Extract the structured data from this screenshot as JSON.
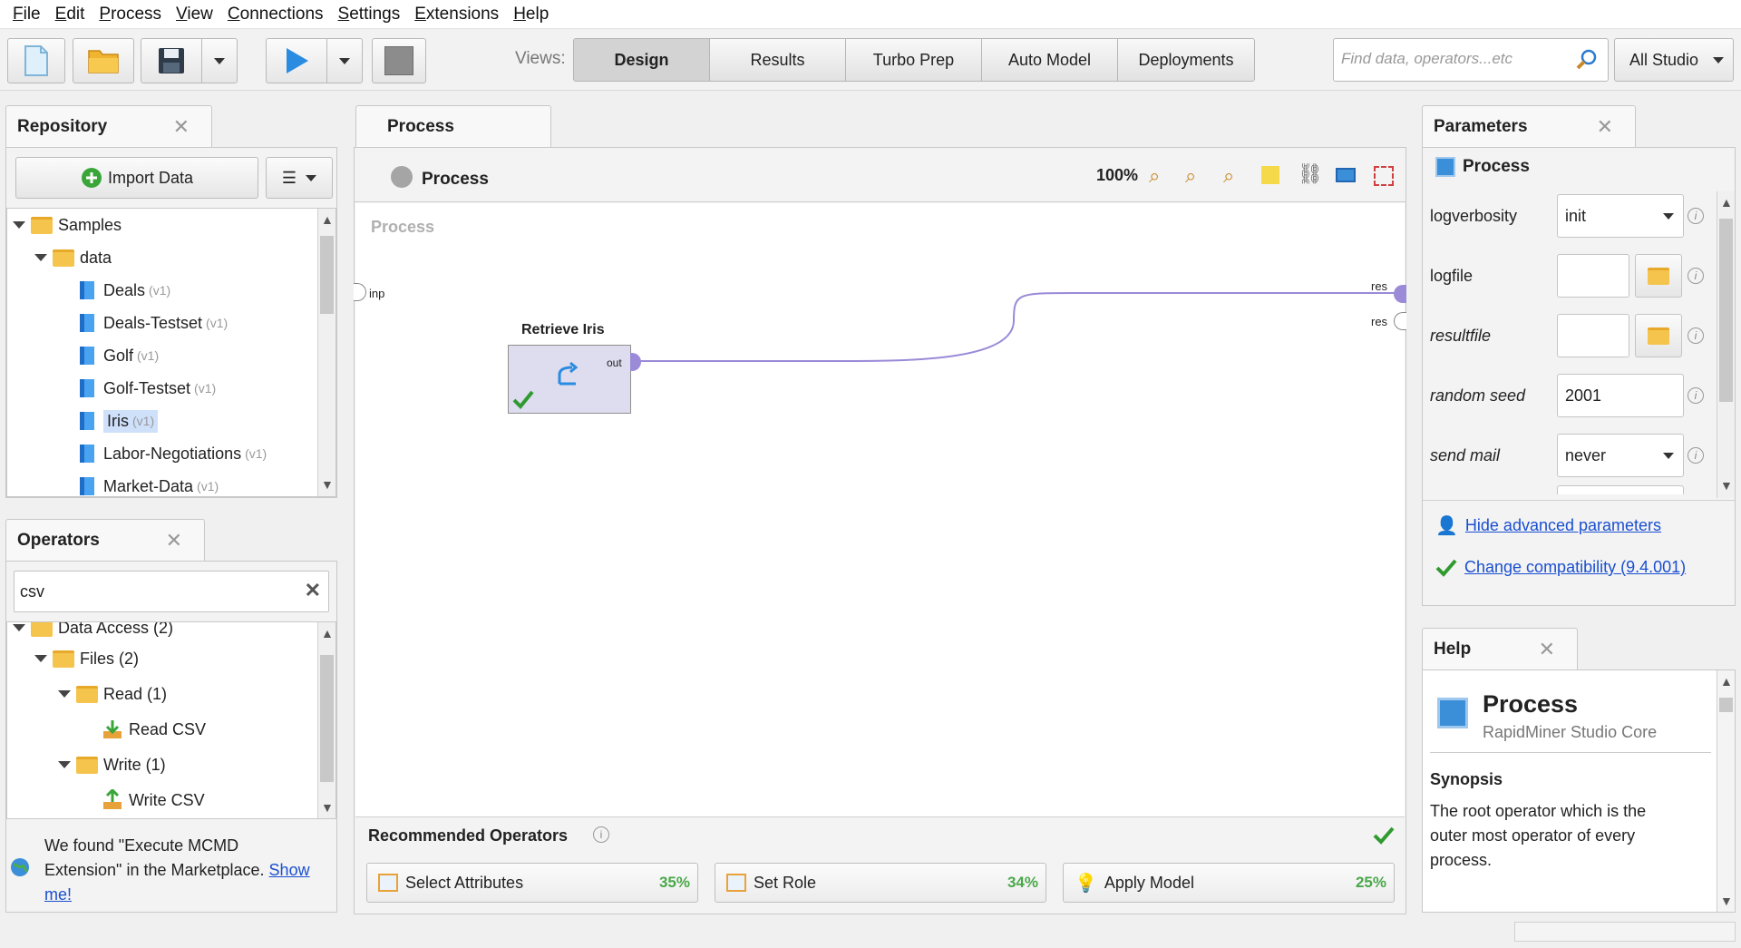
{
  "menu": [
    {
      "u": "F",
      "rest": "ile"
    },
    {
      "u": "E",
      "rest": "dit"
    },
    {
      "u": "P",
      "rest": "rocess"
    },
    {
      "u": "V",
      "rest": "iew"
    },
    {
      "u": "C",
      "rest": "onnections"
    },
    {
      "u": "S",
      "rest": "ettings"
    },
    {
      "u": "E",
      "rest": "xtensions"
    },
    {
      "u": "H",
      "rest": "elp"
    }
  ],
  "toolbar": {
    "views_label": "Views:",
    "views": [
      "Design",
      "Results",
      "Turbo Prep",
      "Auto Model",
      "Deployments"
    ],
    "active_view": "Design",
    "search_placeholder": "Find data, operators...etc",
    "scope": "All Studio"
  },
  "repository": {
    "title": "Repository",
    "import_label": "Import Data",
    "items": [
      {
        "label": "Samples",
        "type": "folder",
        "level": 0,
        "version": ""
      },
      {
        "label": "data",
        "type": "folder-locked",
        "level": 1,
        "version": ""
      },
      {
        "label": "Deals",
        "type": "dataset",
        "level": 2,
        "version": "(v1)"
      },
      {
        "label": "Deals-Testset",
        "type": "dataset",
        "level": 2,
        "version": "(v1)"
      },
      {
        "label": "Golf",
        "type": "dataset",
        "level": 2,
        "version": "(v1)"
      },
      {
        "label": "Golf-Testset",
        "type": "dataset",
        "level": 2,
        "version": "(v1)"
      },
      {
        "label": "Iris",
        "type": "dataset",
        "level": 2,
        "version": "(v1)",
        "selected": true
      },
      {
        "label": "Labor-Negotiations",
        "type": "dataset",
        "level": 2,
        "version": "(v1)"
      },
      {
        "label": "Market-Data",
        "type": "dataset",
        "level": 2,
        "version": "(v1)"
      }
    ]
  },
  "operators": {
    "title": "Operators",
    "search_value": "csv",
    "items": [
      {
        "label": "Data Access (2)",
        "type": "folder",
        "level": 0
      },
      {
        "label": "Files (2)",
        "type": "folder",
        "level": 1
      },
      {
        "label": "Read (1)",
        "type": "folder",
        "level": 2
      },
      {
        "label": "Read CSV",
        "type": "op-read",
        "level": 3
      },
      {
        "label": "Write (1)",
        "type": "folder",
        "level": 2
      },
      {
        "label": "Write CSV",
        "type": "op-write",
        "level": 3
      }
    ],
    "marketplace_text1": "We found \"Execute MCMD",
    "marketplace_text2": "Extension\" in the Marketplace.",
    "marketplace_link1": "Show",
    "marketplace_link2": "me!"
  },
  "process": {
    "tab_title": "Process",
    "breadcrumb": "Process",
    "zoom": "100%",
    "canvas_watermark": "Process",
    "port_inp": "inp",
    "port_res1": "res",
    "port_res2": "res",
    "operator_name": "Retrieve Iris",
    "operator_port": "out"
  },
  "recommended": {
    "title": "Recommended Operators",
    "items": [
      {
        "label": "Select Attributes",
        "pct": "35%"
      },
      {
        "label": "Set Role",
        "pct": "34%"
      },
      {
        "label": "Apply Model",
        "pct": "25%"
      }
    ]
  },
  "parameters": {
    "title": "Parameters",
    "context": "Process",
    "rows": [
      {
        "label": "logverbosity",
        "value": "init",
        "kind": "select",
        "italic": false
      },
      {
        "label": "logfile",
        "value": "",
        "kind": "file",
        "italic": false
      },
      {
        "label": "resultfile",
        "value": "",
        "kind": "file",
        "italic": true
      },
      {
        "label": "random seed",
        "value": "2001",
        "kind": "text",
        "italic": true
      },
      {
        "label": "send mail",
        "value": "never",
        "kind": "select",
        "italic": true
      }
    ],
    "hide_advanced": "Hide advanced parameters",
    "change_compat": "Change compatibility (9.4.001)"
  },
  "help": {
    "title": "Help",
    "op_name": "Process",
    "op_source": "RapidMiner Studio Core",
    "synopsis_title": "Synopsis",
    "synopsis_l1": "The root operator which is the",
    "synopsis_l2": "outer most operator of every",
    "synopsis_l3": "process."
  },
  "colors": {
    "accent": "#1a4fd0",
    "connection": "#9a8ad8",
    "operator_fill": "#dedcef",
    "success": "#2f9a2f"
  }
}
